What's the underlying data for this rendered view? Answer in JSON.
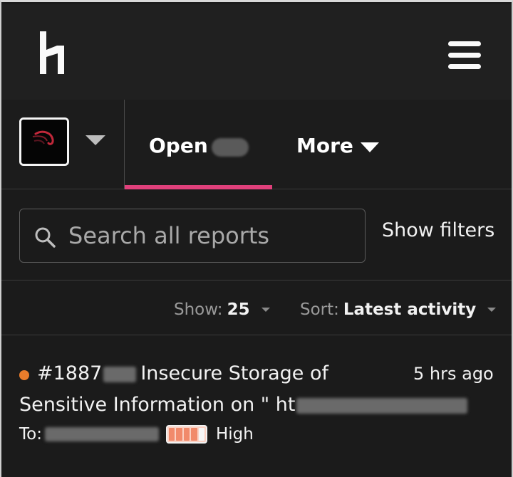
{
  "header": {
    "logo_icon": "hackerone-logo-icon",
    "menu_icon": "hamburger-menu-icon"
  },
  "tabs": {
    "program_avatar_icon": "program-avatar-icon",
    "open_label": "Open",
    "more_label": "More"
  },
  "search": {
    "placeholder": "Search all reports",
    "show_filters_label": "Show filters"
  },
  "controls": {
    "show_label": "Show:",
    "show_value": "25",
    "sort_label": "Sort:",
    "sort_value": "Latest activity"
  },
  "report": {
    "id_prefix": "#1887",
    "title_part1": "Insecure Storage of",
    "title_part2": "Sensitive Information on \" ht",
    "time_ago": "5 hrs ago",
    "to_label": "To:",
    "severity_label": "High",
    "severity_level": 4,
    "severity_max": 5,
    "status_color": "#e97c2b"
  },
  "colors": {
    "accent": "#e0407b",
    "background": "#1b1b1b"
  }
}
